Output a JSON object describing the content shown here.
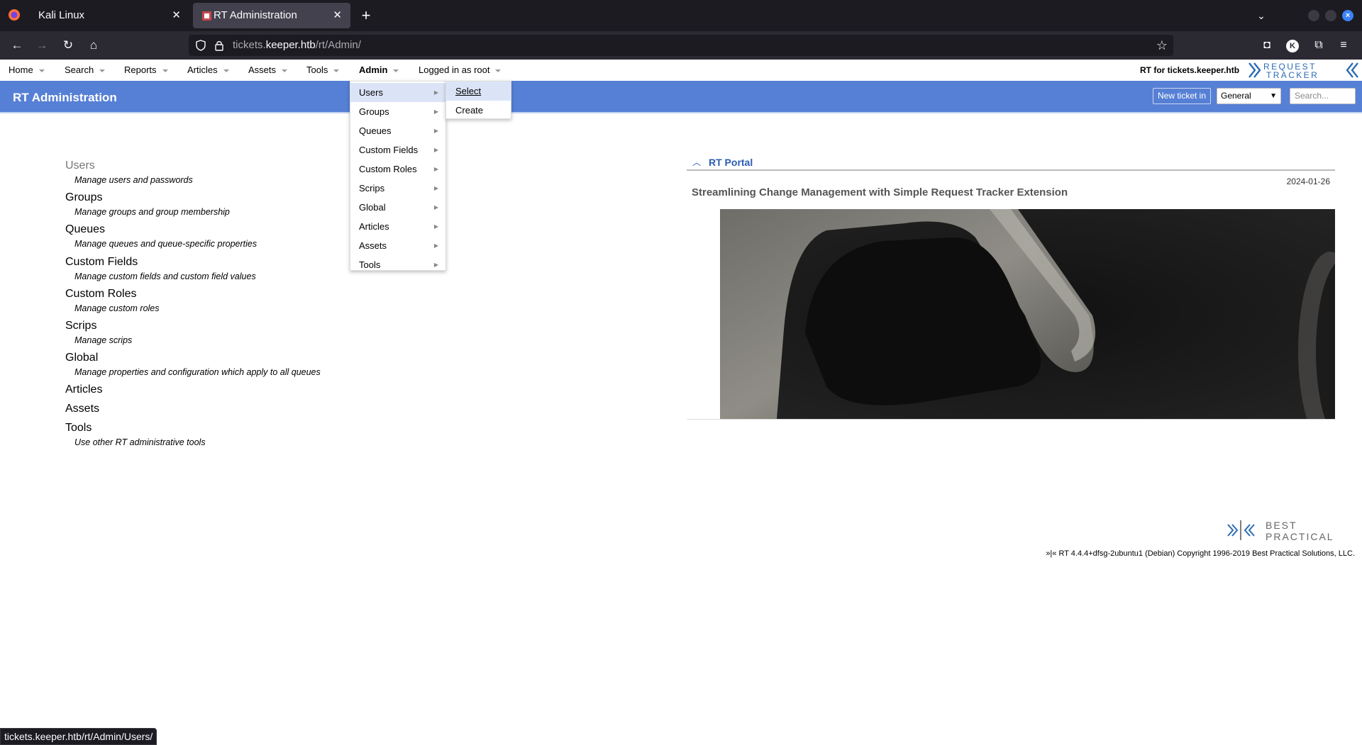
{
  "browser": {
    "tabs": [
      {
        "title": "Kali Linux",
        "active": false
      },
      {
        "title": "RT Administration",
        "active": true
      }
    ],
    "new_tab_icon": "plus-icon",
    "url": {
      "subdomain": "tickets.",
      "domain": "keeper.htb",
      "path": "/rt/Admin/"
    },
    "status_url": "tickets.keeper.htb/rt/Admin/Users/",
    "colors": {
      "chrome_dark": "#1c1b22",
      "toolbar": "#2b2a33",
      "active_tab": "#42414d",
      "close_accent": "#3b82f6"
    }
  },
  "menu": {
    "items": [
      {
        "label": "Home"
      },
      {
        "label": "Search"
      },
      {
        "label": "Reports"
      },
      {
        "label": "Articles"
      },
      {
        "label": "Assets"
      },
      {
        "label": "Tools"
      },
      {
        "label": "Admin"
      },
      {
        "label": "Logged in as root"
      }
    ],
    "rt_for": "RT for tickets.keeper.htb",
    "logo_text": [
      "REQUEST",
      "TRACKER"
    ]
  },
  "header": {
    "title": "RT Administration",
    "new_ticket_label": "New ticket in",
    "queue_selected": "General",
    "search_placeholder": "Search...",
    "color": "#5680d5"
  },
  "admin_items": [
    {
      "title": "Users",
      "desc": "Manage users and passwords"
    },
    {
      "title": "Groups",
      "desc": "Manage groups and group membership"
    },
    {
      "title": "Queues",
      "desc": "Manage queues and queue-specific properties"
    },
    {
      "title": "Custom Fields",
      "desc": "Manage custom fields and custom field values"
    },
    {
      "title": "Custom Roles",
      "desc": "Manage custom roles"
    },
    {
      "title": "Scrips",
      "desc": "Manage scrips"
    },
    {
      "title": "Global",
      "desc": "Manage properties and configuration which apply to all queues"
    },
    {
      "title": "Articles",
      "desc": ""
    },
    {
      "title": "Assets",
      "desc": ""
    },
    {
      "title": "Tools",
      "desc": "Use other RT administrative tools"
    }
  ],
  "dropdown": {
    "items": [
      "Users",
      "Groups",
      "Queues",
      "Custom Fields",
      "Custom Roles",
      "Scrips",
      "Global",
      "Articles",
      "Assets",
      "Tools"
    ],
    "submenu": [
      "Select",
      "Create"
    ]
  },
  "portal": {
    "title": "RT Portal",
    "date": "2024-01-26",
    "article_title": "Streamlining Change Management with Simple Request Tracker Extension"
  },
  "footer": {
    "logo_text": [
      "BEST",
      "PRACTICAL"
    ],
    "copyright": "»|« RT 4.4.4+dfsg-2ubuntu1 (Debian) Copyright 1996-2019 Best Practical Solutions, LLC."
  }
}
